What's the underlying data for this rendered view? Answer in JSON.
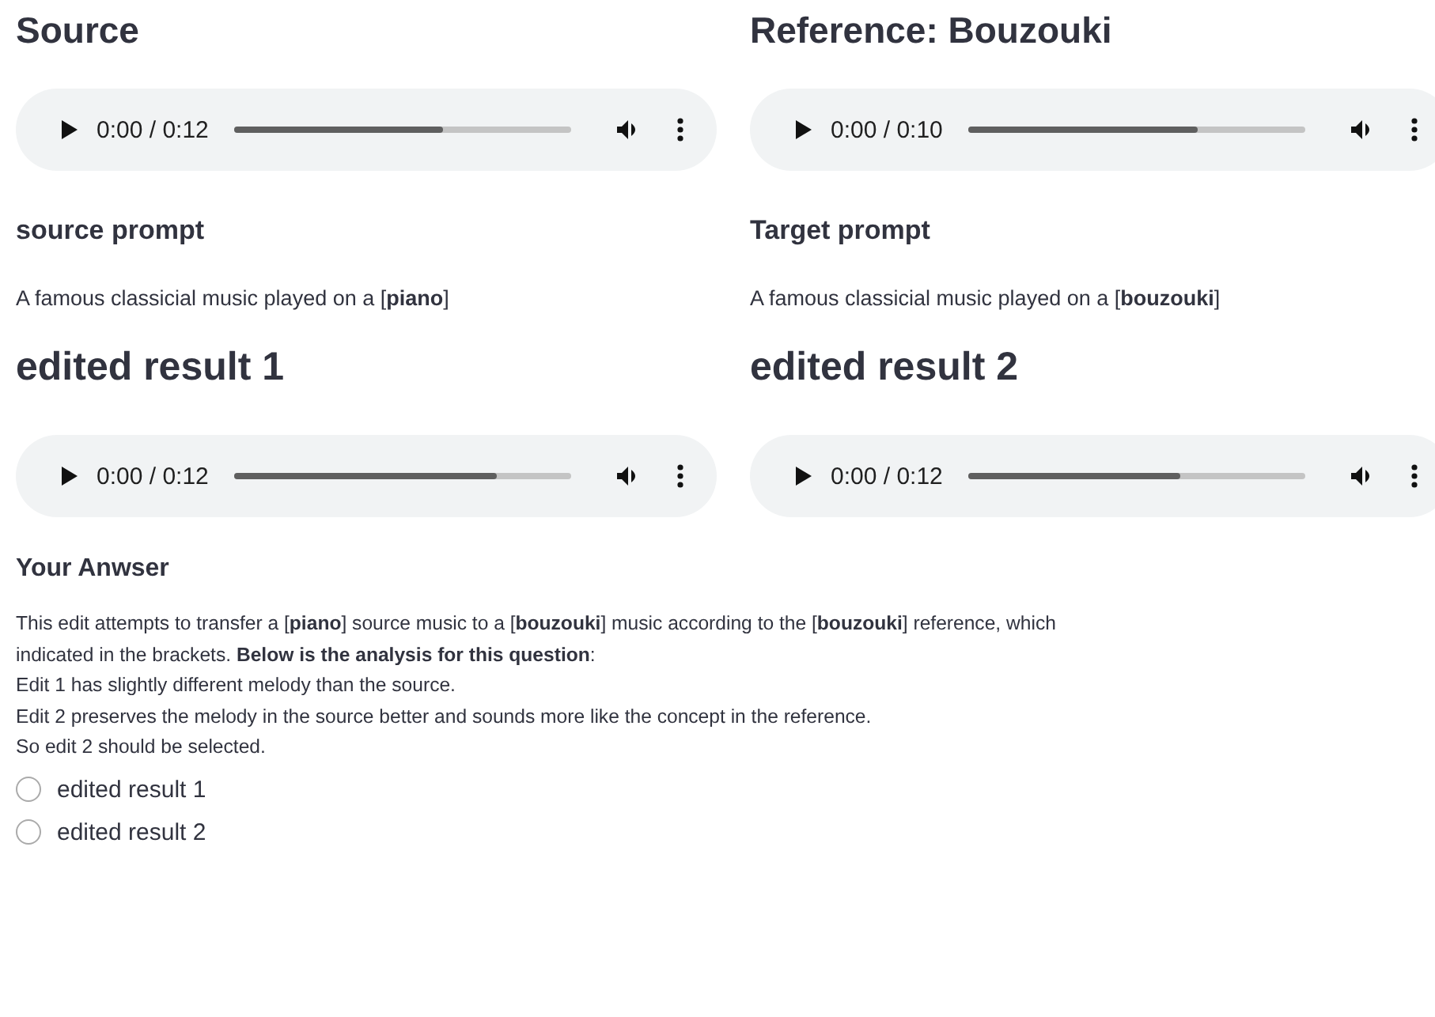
{
  "panels": [
    {
      "title": "Source",
      "player": {
        "time": "0:00 / 0:12",
        "level": 0.62
      },
      "prompt_heading": "source prompt",
      "prompt": "A famous classicial music played on a [**piano**]"
    },
    {
      "title": "Reference: Bouzouki",
      "player": {
        "time": "0:00 / 0:10",
        "level": 0.68
      },
      "prompt_heading": "Target prompt",
      "prompt": "A famous classicial music played on a [**bouzouki**]"
    },
    {
      "title": "edited result 1",
      "player": {
        "time": "0:00 / 0:12",
        "level": 0.78
      }
    },
    {
      "title": "edited result 2",
      "player": {
        "time": "0:00 / 0:12",
        "level": 0.63
      }
    }
  ],
  "answer": {
    "heading": "Your Anwser",
    "lines": [
      "This edit attempts to transfer a [**piano**] source music to a [**bouzouki**] music according to the [**bouzouki**] reference, which",
      "indicated in the brackets. **Below is the analysis for this question**:",
      "Edit 1 has slightly different melody than the source.",
      "Edit 2 preserves the melody in the source better and sounds more like the concept in the reference.",
      "So edit 2 should be selected."
    ],
    "options": [
      {
        "label": "edited result 1",
        "selected": false
      },
      {
        "label": "edited result 2",
        "selected": false
      }
    ]
  }
}
